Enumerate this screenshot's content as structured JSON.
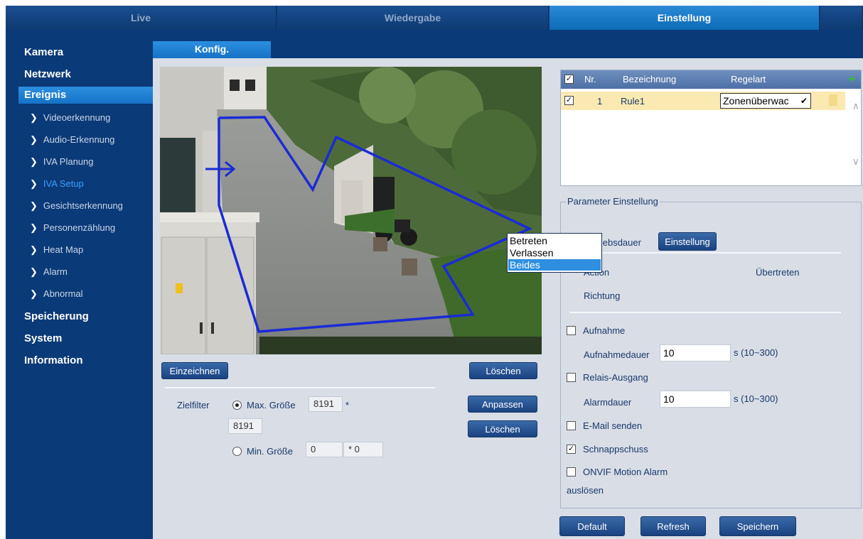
{
  "topnav": {
    "tabs": [
      {
        "label": "Live"
      },
      {
        "label": "Wiedergabe"
      },
      {
        "label": "Einstellung"
      }
    ]
  },
  "sidebar": {
    "main": [
      "Kamera",
      "Netzwerk",
      "Ereignis",
      "Speicherung",
      "System",
      "Information"
    ],
    "sub": [
      "Videoerkennung",
      "Audio-Erkennung",
      "IVA Planung",
      "IVA Setup",
      "Gesichtserkennung",
      "Personenzählung",
      "Heat Map",
      "Alarm",
      "Abnormal"
    ]
  },
  "main": {
    "subtab": "Konfig.",
    "draw_button": "Einzeichnen",
    "delete_button_top": "Löschen",
    "target_filter": {
      "label": "Zielfilter",
      "max_label": "Max. Größe",
      "max_w": "8191",
      "times": "*",
      "max_h": "8191",
      "min_label": "Min. Größe",
      "min_w": "0",
      "min_h": "0",
      "min_times": "* 0",
      "selected": "max"
    },
    "adjust_button": "Anpassen",
    "delete_button_bottom": "Löschen"
  },
  "rules": {
    "headers": {
      "nr": "Nr.",
      "name": "Bezeichnung",
      "type": "Regelart"
    },
    "rows": [
      {
        "checked": true,
        "nr": "1",
        "name": "Rule1",
        "type": "Zonenüberwac"
      }
    ]
  },
  "params": {
    "title": "Parameter Einstellung",
    "operating_time_label": "Betriebsdauer",
    "operating_time_button": "Einstellung",
    "action_label": "Action",
    "action_suffix": "Übertreten",
    "direction_label": "Richtung",
    "dropdown_options": [
      "Betreten",
      "Verlassen",
      "Beides"
    ],
    "dropdown_selected": "Beides",
    "record_label": "Aufnahme",
    "record_checked": false,
    "record_duration_label": "Aufnahmedauer",
    "record_duration_value": "10",
    "record_duration_range": "s (10~300)",
    "relay_label": "Relais-Ausgang",
    "relay_checked": false,
    "alarm_duration_label": "Alarmdauer",
    "alarm_duration_value": "10",
    "alarm_duration_range": "s (10~300)",
    "email_label": "E-Mail senden",
    "email_checked": false,
    "snapshot_label": "Schnappschuss",
    "snapshot_checked": true,
    "onvif_label": "ONVIF Motion Alarm",
    "onvif_label2": "auslösen",
    "onvif_checked": false
  },
  "footer": {
    "default_button": "Default",
    "refresh_button": "Refresh",
    "save_button": "Speichern"
  },
  "colors": {
    "nav_bg": "#0b3a78",
    "accent": "#1672c6",
    "zone_line": "#1a2bd6",
    "row_highlight": "#fbe9b2",
    "add_icon": "#3cb83c"
  }
}
